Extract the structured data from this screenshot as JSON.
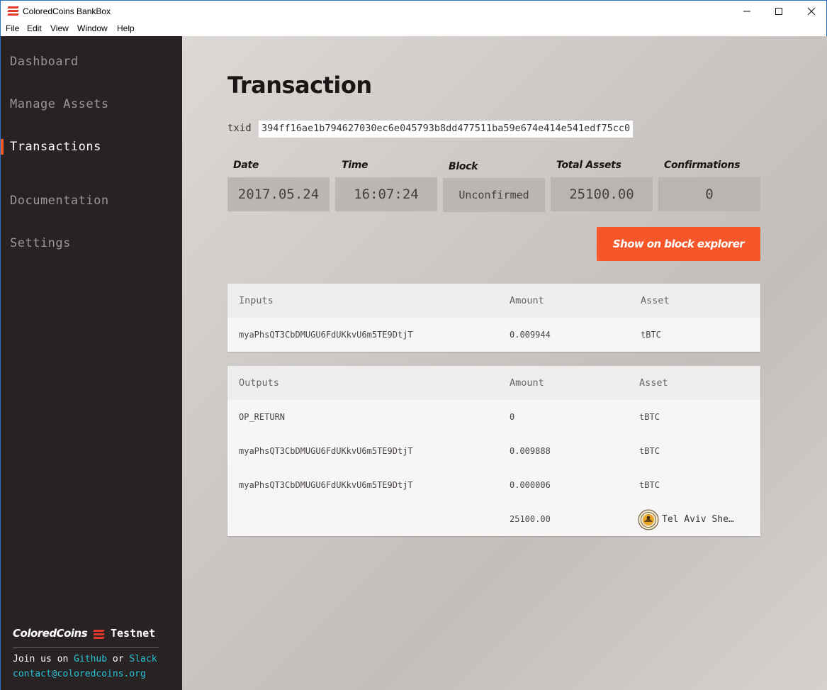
{
  "window": {
    "title": "ColoredCoins BankBox",
    "min_icon": "minimize-icon",
    "max_icon": "maximize-icon",
    "close_icon": "close-icon"
  },
  "menu": [
    "File",
    "Edit",
    "View",
    "Window",
    "Help"
  ],
  "sidebar": {
    "items": [
      {
        "label": "Dashboard",
        "active": false
      },
      {
        "label": "Manage Assets",
        "active": false
      },
      {
        "label": "Transactions",
        "active": true
      },
      {
        "label": "Documentation",
        "active": false
      },
      {
        "label": "Settings",
        "active": false
      }
    ],
    "footer": {
      "brand": "ColoredCoins",
      "network": "Testnet",
      "join_prefix": "Join us on",
      "github": "Github",
      "or": "or",
      "slack": "Slack",
      "email": "contact@coloredcoins.org"
    }
  },
  "page": {
    "title": "Transaction",
    "txid_label": "txid",
    "txid": "394ff16ae1b794627030ec6e045793b8dd477511ba59e674e414e541edf75cc0",
    "stats": {
      "date_label": "Date",
      "date": "2017.05.24",
      "time_label": "Time",
      "time": "16:07:24",
      "block_label": "Block",
      "block": "Unconfirmed",
      "total_label": "Total Assets",
      "total": "25100.00",
      "conf_label": "Confirmations",
      "conf": "0"
    },
    "explorer_button": "Show on block explorer"
  },
  "inputs": {
    "headers": [
      "Inputs",
      "Amount",
      "Asset"
    ],
    "rows": [
      {
        "address": "myaPhsQT3CbDMUGU6FdUKkvU6m5TE9DtjT",
        "amount": "0.009944",
        "asset": "tBTC"
      }
    ]
  },
  "outputs": {
    "headers": [
      "Outputs",
      "Amount",
      "Asset"
    ],
    "rows": [
      {
        "address": "OP_RETURN",
        "amount": "0",
        "asset": "tBTC"
      },
      {
        "address": "myaPhsQT3CbDMUGU6FdUKkvU6m5TE9DtjT",
        "amount": "0.009888",
        "asset": "tBTC"
      },
      {
        "address": "myaPhsQT3CbDMUGU6FdUKkvU6m5TE9DtjT",
        "amount": "0.000006",
        "asset": "tBTC"
      },
      {
        "address": "",
        "amount": "25100.00",
        "asset": "Tel Aviv She…",
        "asset_icon": "asset-logo-icon"
      }
    ]
  },
  "colors": {
    "sidebar_bg": "#292222",
    "accent": "#f5572a",
    "link": "#27c2d5"
  }
}
